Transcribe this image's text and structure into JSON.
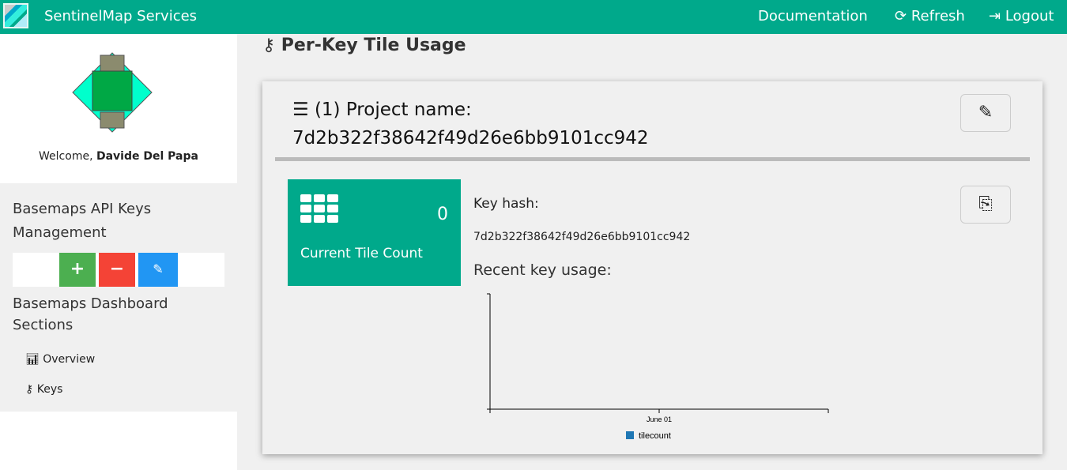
{
  "header": {
    "brand": "SentinelMap Services",
    "nav": [
      {
        "icon": "book-icon",
        "label": "Documentation"
      },
      {
        "icon": "refresh-icon",
        "label": "Refresh"
      },
      {
        "icon": "logout-icon",
        "label": "Logout"
      }
    ]
  },
  "sidebar": {
    "welcome_prefix": "Welcome, ",
    "user": "Davide Del Papa",
    "keys_title": "Basemaps API Keys Management",
    "buttons": [
      {
        "label": "+",
        "color": "#4caf50"
      },
      {
        "label": "−",
        "color": "#f44336"
      },
      {
        "label": "✎",
        "color": "#2196f3"
      }
    ],
    "sections_title": "Basemaps Dashboard Sections",
    "items": [
      {
        "icon": "bar-chart-icon",
        "label": "Overview"
      },
      {
        "icon": "key-icon",
        "label": "Keys"
      }
    ]
  },
  "main": {
    "title": "Per-Key Tile Usage",
    "project_label": "(1) Project name:",
    "project_name": "7d2b322f38642f49d26e6bb9101cc942",
    "tile_count": "0",
    "tile_label": "Current Tile Count",
    "key_hash_label": "Key hash:",
    "key_hash": "7d2b322f38642f49d26e6bb9101cc942",
    "usage_label": "Recent key usage:"
  },
  "colors": {
    "brand": "#00a98b"
  },
  "chart_data": {
    "type": "line",
    "x_ticks": [
      "June 01"
    ],
    "series": [
      {
        "name": "tilecount",
        "color": "#1f77b4",
        "values": []
      }
    ],
    "legend": "bottom"
  }
}
